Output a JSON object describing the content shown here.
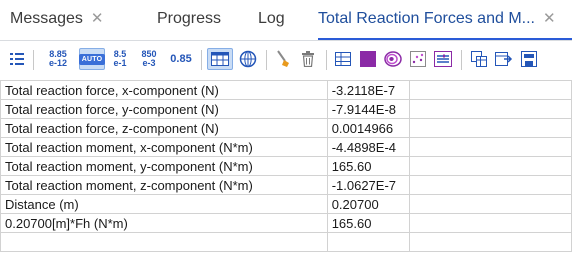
{
  "tabs": [
    {
      "label": "Messages",
      "closable": true,
      "active": false
    },
    {
      "label": "Progress",
      "closable": false,
      "active": false
    },
    {
      "label": "Log",
      "closable": false,
      "active": false
    },
    {
      "label": "Total Reaction Forces and M...",
      "closable": true,
      "active": true
    }
  ],
  "toolbar": {
    "precision_a_top": "8.85",
    "precision_a_bottom": "e-12",
    "auto_label": "AUTO",
    "precision_b_top": "8.5",
    "precision_b_bottom": "e-1",
    "precision_c_top": "850",
    "precision_c_bottom": "e-3",
    "precision_d": "0.85"
  },
  "table": {
    "rows": [
      {
        "label": "Total reaction force, x-component (N)",
        "value": "-3.2118E-7"
      },
      {
        "label": "Total reaction force, y-component (N)",
        "value": "-7.9144E-8"
      },
      {
        "label": "Total reaction force, z-component (N)",
        "value": "0.0014966"
      },
      {
        "label": "Total reaction moment, x-component (N*m)",
        "value": "-4.4898E-4"
      },
      {
        "label": "Total reaction moment, y-component (N*m)",
        "value": "165.60"
      },
      {
        "label": "Total reaction moment, z-component (N*m)",
        "value": "-1.0627E-7"
      },
      {
        "label": "Distance (m)",
        "value": "0.20700"
      },
      {
        "label": "0.20700[m]*Fh (N*m)",
        "value": "165.60"
      }
    ]
  },
  "colors": {
    "accent": "#2a5bd7",
    "active_tab_text": "#1f4e9c",
    "grid_line": "#d2d2d2"
  }
}
